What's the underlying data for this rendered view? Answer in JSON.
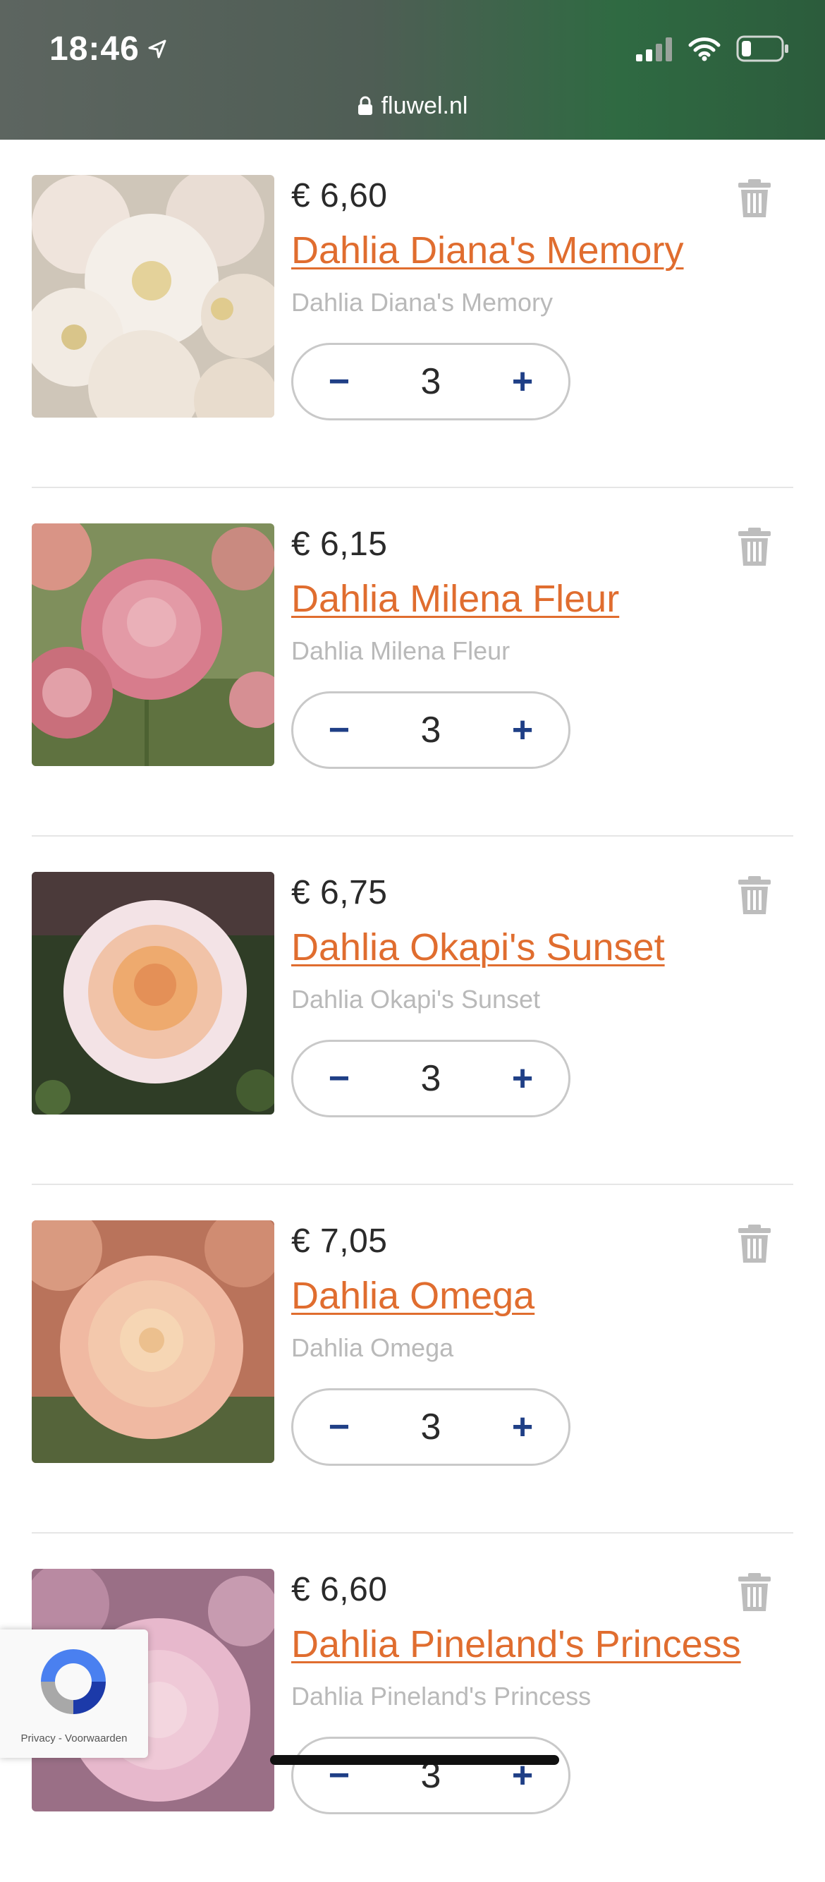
{
  "status_bar": {
    "time": "18:46"
  },
  "browser": {
    "url": "fluwel.nl"
  },
  "colors": {
    "title": "#e06d2f",
    "stepper": "#1f3f86",
    "subtitle": "#b9b9b9"
  },
  "cart": {
    "items": [
      {
        "price": "€ 6,60",
        "title": "Dahlia Diana's Memory",
        "subtitle": "Dahlia Diana's Memory",
        "quantity": "3",
        "minus": "−",
        "plus": "+"
      },
      {
        "price": "€ 6,15",
        "title": "Dahlia Milena Fleur",
        "subtitle": "Dahlia Milena Fleur",
        "quantity": "3",
        "minus": "−",
        "plus": "+"
      },
      {
        "price": "€ 6,75",
        "title": "Dahlia Okapi's Sunset",
        "subtitle": "Dahlia Okapi's Sunset",
        "quantity": "3",
        "minus": "−",
        "plus": "+"
      },
      {
        "price": "€ 7,05",
        "title": "Dahlia Omega",
        "subtitle": "Dahlia Omega",
        "quantity": "3",
        "minus": "−",
        "plus": "+"
      },
      {
        "price": "€ 6,60",
        "title": "Dahlia Pineland's Princess",
        "subtitle": "Dahlia Pineland's Princess",
        "quantity": "3",
        "minus": "−",
        "plus": "+"
      }
    ]
  },
  "recaptcha": {
    "links": "Privacy - Voorwaarden"
  }
}
